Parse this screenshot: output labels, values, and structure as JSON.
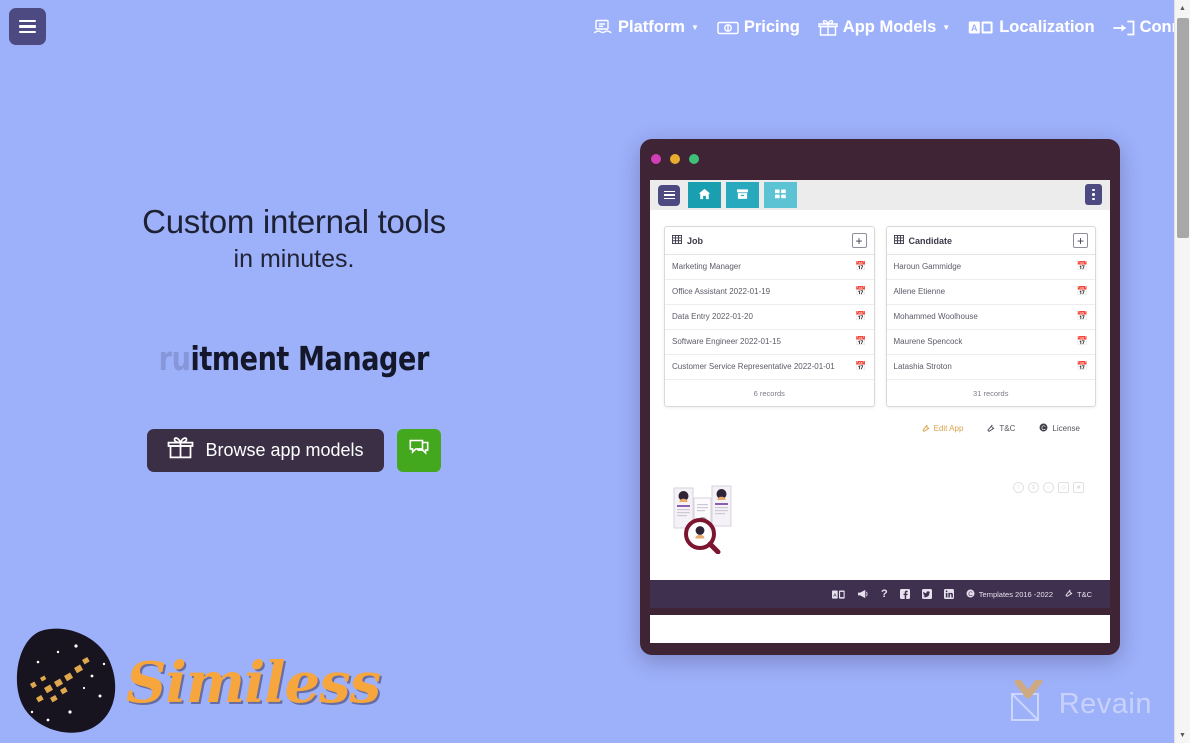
{
  "theme": {
    "page_background": "#9db0fa",
    "accent_dark": "#3a2f45",
    "accent_green": "#44a81e",
    "window_chrome": "#3f2435",
    "breadcrumb_teal": "#199fb0",
    "logo_orange": "#f6a63c",
    "edit_link_color": "#d9a44f"
  },
  "topbar": {
    "menu_button": "menu-icon",
    "nav": [
      {
        "label": "Platform",
        "icon": "platform-icon",
        "has_caret": true
      },
      {
        "label": "Pricing",
        "icon": "pricing-icon",
        "has_caret": false
      },
      {
        "label": "App Models",
        "icon": "gift-box-icon",
        "has_caret": true
      },
      {
        "label": "Localization",
        "icon": "localization-icon",
        "has_caret": false
      },
      {
        "label": "Connect",
        "icon": "login-arrow-icon",
        "has_caret": false
      }
    ]
  },
  "hero": {
    "title": "Custom internal tools",
    "subtitle": "in minutes.",
    "typed_faded": "ru",
    "typed_visible": "itment Manager",
    "browse_button": "Browse app models",
    "browse_icon": "gift-box-icon",
    "chat_icon": "chat-bubbles-icon"
  },
  "app_window": {
    "dots": [
      "close",
      "minimize",
      "maximize"
    ],
    "toolbar": {
      "menu_button": "menu-icon",
      "breadcrumb": [
        {
          "icon": "home-icon",
          "name": "home"
        },
        {
          "icon": "archive-icon",
          "name": "archive"
        },
        {
          "icon": "grid-icon",
          "name": "grid"
        }
      ],
      "overflow_button": "more-vertical-icon"
    },
    "panels": [
      {
        "title": "Job",
        "icon": "table-icon",
        "add_label": "+",
        "rows": [
          {
            "text": "Marketing Manager",
            "icon": "calendar-icon"
          },
          {
            "text": "Office Assistant  2022-01-19",
            "icon": "calendar-icon"
          },
          {
            "text": "Data Entry  2022-01-20",
            "icon": "calendar-icon"
          },
          {
            "text": "Software Engineer  2022-01-15",
            "icon": "calendar-icon"
          },
          {
            "text": "Customer Service Representative  2022-01-01",
            "icon": "calendar-icon"
          }
        ],
        "footer": "6 records"
      },
      {
        "title": "Candidate",
        "icon": "table-icon",
        "add_label": "+",
        "rows": [
          {
            "text": "Haroun Gammidge",
            "icon": "calendar-icon"
          },
          {
            "text": "Allene Etienne",
            "icon": "calendar-icon"
          },
          {
            "text": "Mohammed Woolhouse",
            "icon": "calendar-icon"
          },
          {
            "text": "Maurene Spencock",
            "icon": "calendar-icon"
          },
          {
            "text": "Latashia Stroton",
            "icon": "calendar-icon"
          }
        ],
        "footer": "31 records"
      }
    ],
    "actions": [
      {
        "label": "Edit App",
        "icon": "wrench-icon",
        "highlight": true
      },
      {
        "label": "T&C",
        "icon": "wrench-icon",
        "highlight": false
      },
      {
        "label": "License",
        "icon": "copyleft-icon",
        "highlight": false
      }
    ],
    "faint_icons": [
      "facebook-icon",
      "dollar-icon",
      "chat-icon",
      "search-icon",
      "stamp-icon"
    ],
    "illustration": "candidate-search-illustration",
    "footer": {
      "icons": [
        "localization-icon",
        "megaphone-icon",
        "help-icon",
        "facebook-icon",
        "twitter-icon",
        "linkedin-icon"
      ],
      "copyright_icon": "copyleft-icon",
      "copyright": "Templates 2016 -2022",
      "terms_icon": "wrench-icon",
      "terms": "T&C"
    }
  },
  "branding": {
    "logo_mark": "asteroid-icon",
    "logo_text": "Similess"
  },
  "watermark": {
    "mark": "revain-check-icon",
    "text": "Revain"
  }
}
